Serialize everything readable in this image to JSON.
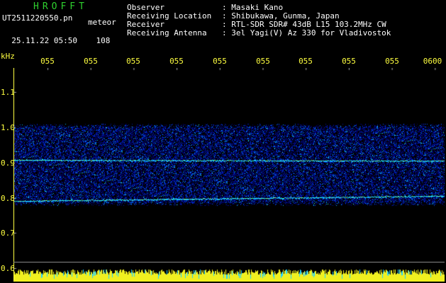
{
  "header": {
    "brand": "HROFFT",
    "file_name": "UT2511220550.pn",
    "meteor_label": "meteor",
    "date": "25.11.22",
    "time": "05:50",
    "count": "108"
  },
  "info": [
    {
      "label": "Observer",
      "value": ": Masaki Kano"
    },
    {
      "label": "Receiving Location",
      "value": ": Shibukawa, Gunma, Japan"
    },
    {
      "label": "Receiver",
      "value": ": RTL-SDR SDR# 43dB L15 103.2MHz CW"
    },
    {
      "label": "Receiving Antenna",
      "value": ": 3el Yagi(V) Az 330 for Vladivostok"
    }
  ],
  "axis": {
    "unit": "kHz",
    "time_ticks": [
      "055",
      "055",
      "055",
      "055",
      "055",
      "055",
      "055",
      "055",
      "055",
      "0600"
    ],
    "freq_ticks": [
      "1.1",
      "1.0",
      "0.9",
      "0.8",
      "0.7",
      "0.6"
    ]
  },
  "colors": {
    "axis": "#ffff40",
    "brand": "#2fd02f",
    "bottom_bar": "#f0f020",
    "bottom_bar_accent": "#20d0ff"
  }
}
